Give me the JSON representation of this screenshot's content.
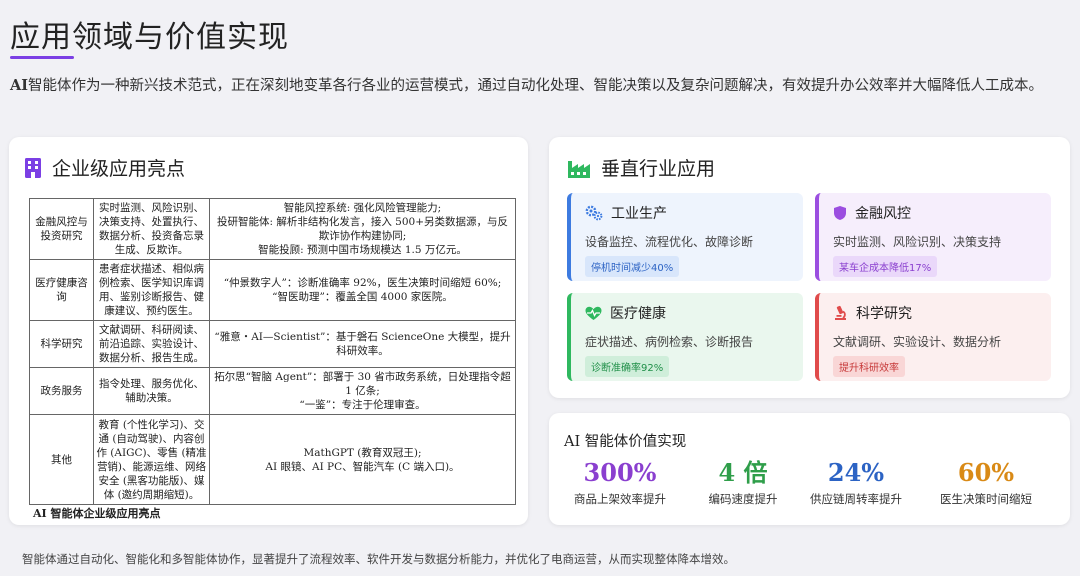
{
  "page": {
    "title": "应用领域与价值实现",
    "intro_bold": "AI",
    "intro_rest": "智能体作为一种新兴技术范式，正在深刻地变革各行各业的运营模式，通过自动化处理、智能决策以及复杂问题解决，有效提升办公效率并大幅降低人工成本。",
    "footer": "智能体通过自动化、智能化和多智能体协作，显著提升了流程效率、软件开发与数据分析能力，并优化了电商运营，从而实现整体降本增效。"
  },
  "enterprise": {
    "heading": "企业级应用亮点",
    "icon": "building-icon",
    "caption": "AI  智能体企业级应用亮点",
    "rows": [
      {
        "field": "金融风控与投资研究",
        "tasks": "实时监测、风险识别、决策支持、处置执行、数据分析、投资备忘录生成、反欺诈。",
        "cases": "智能风控系统: 强化风险管理能力;\n投研智能体: 解析非结构化发言，接入 500+另类数据源，与反欺诈协作构建协同;\n智能投顾: 预测中国市场规模达 1.5 万亿元。"
      },
      {
        "field": "医疗健康咨询",
        "tasks": "患者症状描述、相似病例检索、医学知识库调用、鉴别诊断报告、健康建议、预约医生。",
        "cases": "“仲景数字人”：诊断准确率 92%，医生决策时间缩短 60%;\n“智医助理”：覆盖全国 4000 家医院。"
      },
      {
        "field": "科学研究",
        "tasks": "文献调研、科研阅读、前沿追踪、实验设计、数据分析、报告生成。",
        "cases": "“雅意・AI—Scientist”：基于磐石 ScienceOne 大模型，提升科研效率。"
      },
      {
        "field": "政务服务",
        "tasks": "指令处理、服务优化、辅助决策。",
        "cases": "拓尔思“智脑 Agent”：部署于 30 省市政务系统，日处理指令超 1 亿条;\n“一鉴”：专注于伦理审查。"
      },
      {
        "field": "其他",
        "tasks": "教育 (个性化学习)、交通 (自动驾驶)、内容创作 (AIGC)、零售 (精准营销)、能源运维、网络安全 (黑客功能版)、媒体 (邀约周期缩短)。",
        "cases": "MathGPT (教育双冠王);\nAI 眼镜、AI PC、智能汽车 (C 端入口)。"
      }
    ]
  },
  "vertical": {
    "heading": "垂直行业应用",
    "icon": "factory-icon",
    "tiles": [
      {
        "id": "industry",
        "icon": "gears-icon",
        "icon_color": "#3d7be0",
        "title": "工业生产",
        "desc": "设备监控、流程优化、故障诊断",
        "badge": "停机时间减少40%"
      },
      {
        "id": "finance",
        "icon": "shield-icon",
        "icon_color": "#9b4ee0",
        "title": "金融风控",
        "desc": "实时监测、风险识别、决策支持",
        "badge": "某车企成本降低17%"
      },
      {
        "id": "health",
        "icon": "heartbeat-icon",
        "icon_color": "#2fb85f",
        "title": "医疗健康",
        "desc": "症状描述、病例检索、诊断报告",
        "badge": "诊断准确率92%"
      },
      {
        "id": "science",
        "icon": "microscope-icon",
        "icon_color": "#e04b4b",
        "title": "科学研究",
        "desc": "文献调研、实验设计、数据分析",
        "badge": "提升科研效率"
      }
    ]
  },
  "value": {
    "title": "AI 智能体价值实现",
    "metrics": [
      {
        "value": "300%",
        "label": "商品上架效率提升",
        "color": "#8a3fcf"
      },
      {
        "value": "4 倍",
        "label": "编码速度提升",
        "color": "#2f9e4a"
      },
      {
        "value": "24%",
        "label": "供应链周转率提升",
        "color": "#2c63c4"
      },
      {
        "value": "60%",
        "label": "医生决策时间缩短",
        "color": "#d98a16"
      }
    ]
  },
  "colors": {
    "accent": "#7b3fe4",
    "vertical_icon": "#2fb85f"
  }
}
